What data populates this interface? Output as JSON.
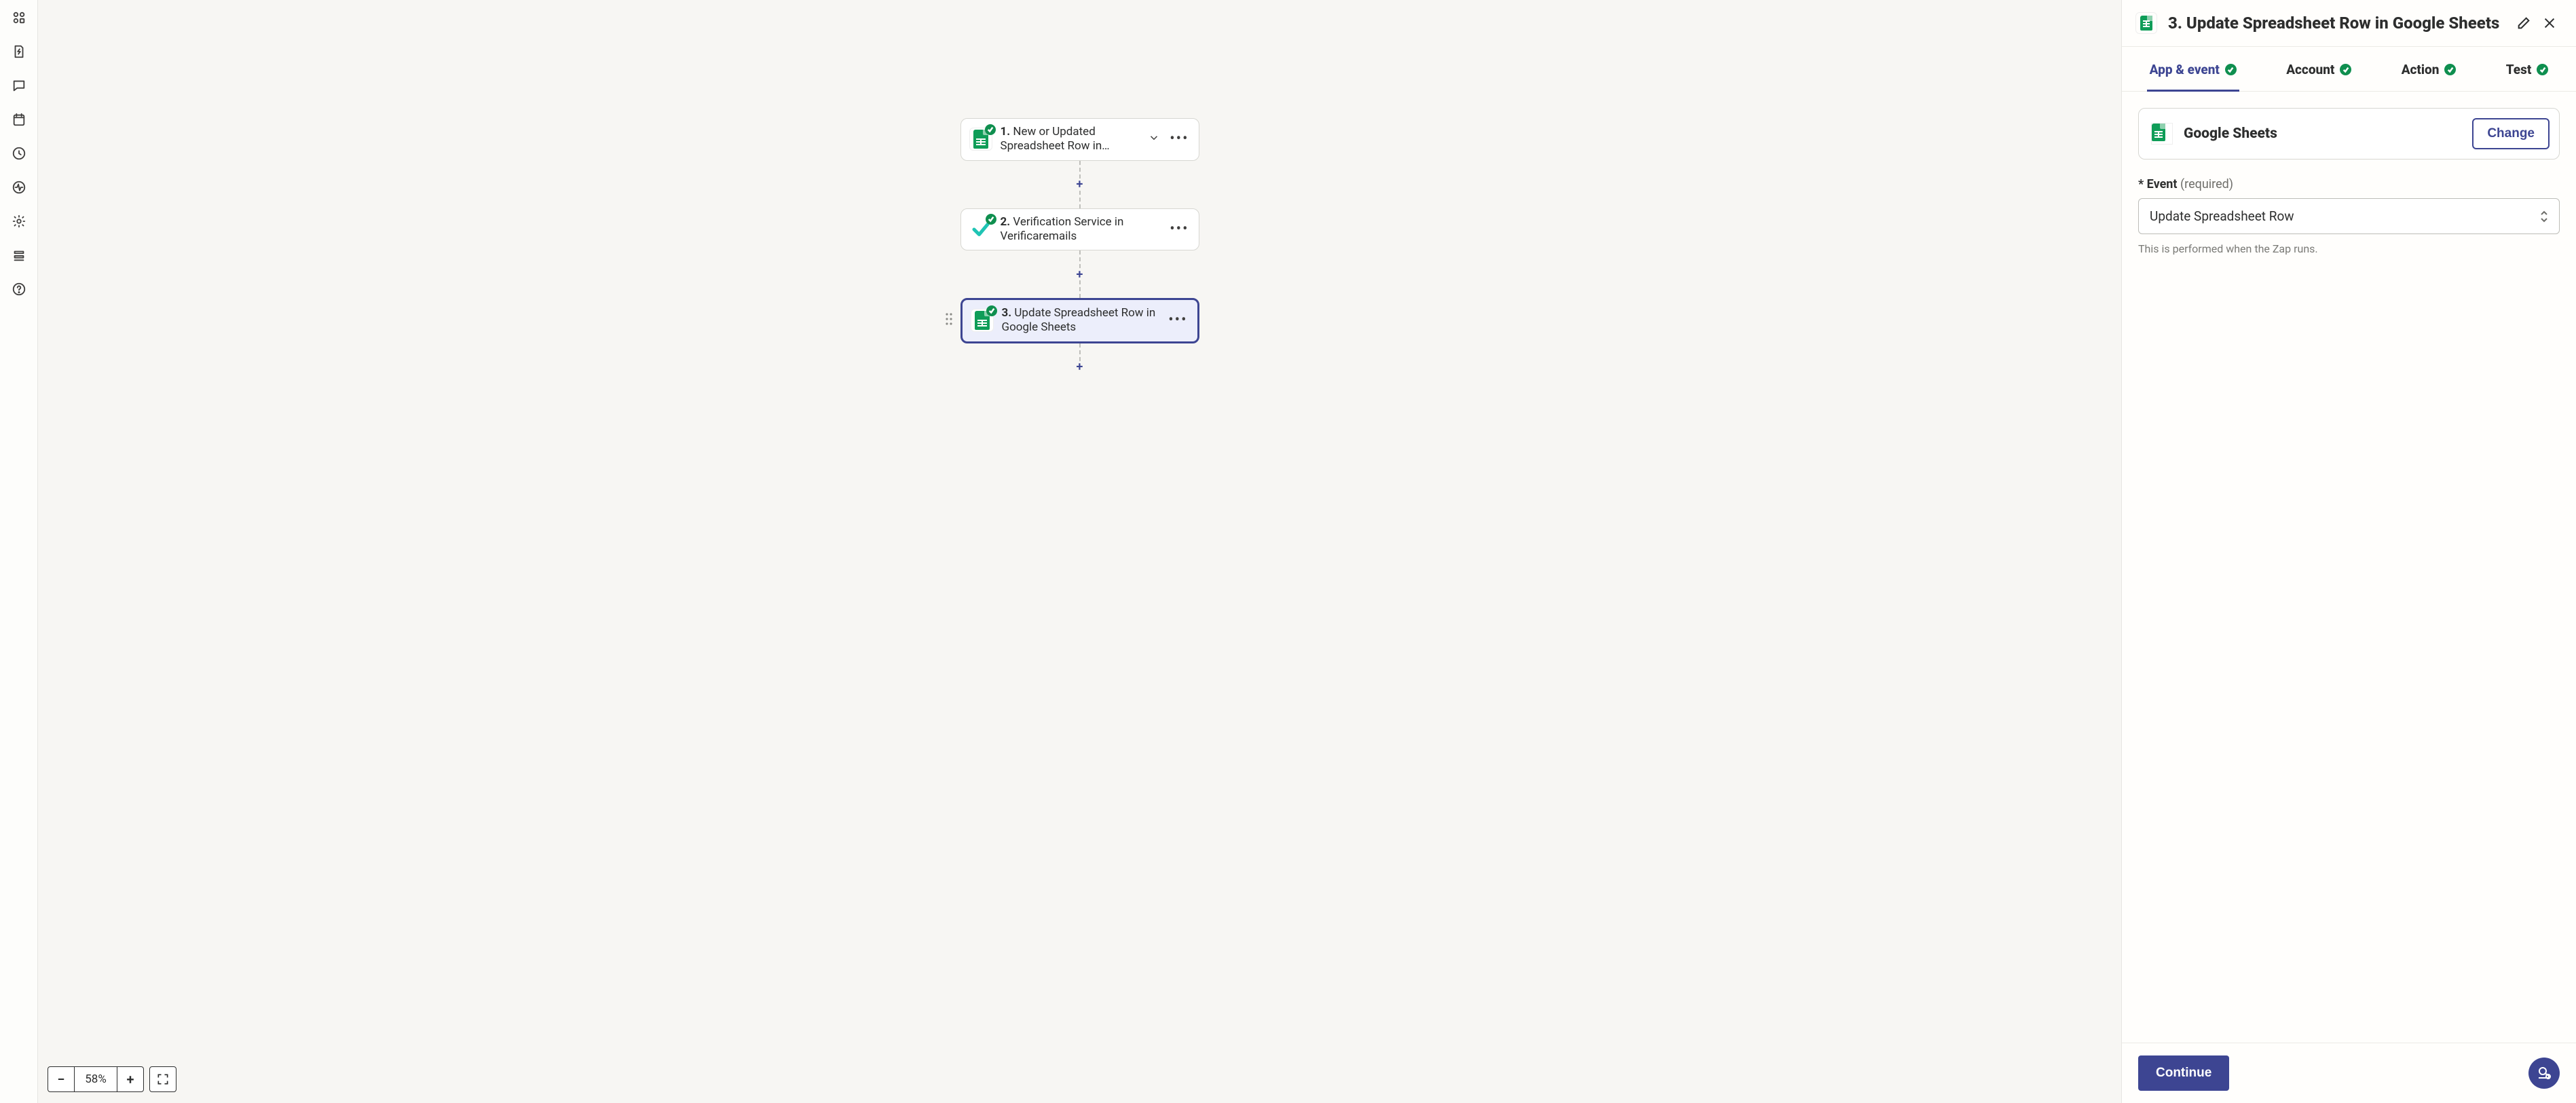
{
  "rail_icons": [
    "grid",
    "bolt-doc",
    "chat",
    "calendar",
    "clock",
    "activity",
    "gear",
    "layers",
    "help"
  ],
  "flow": {
    "nodes": [
      {
        "num": "1.",
        "title": "New or Updated Spreadsheet Row in…",
        "icon": "sheets",
        "showChevron": true
      },
      {
        "num": "2.",
        "title": "Verification Service in Verificaremails",
        "icon": "verify",
        "showChevron": false
      },
      {
        "num": "3.",
        "title": "Update Spreadsheet Row in Google Sheets",
        "icon": "sheets",
        "showChevron": false,
        "selected": true
      }
    ]
  },
  "zoom": {
    "minus": "−",
    "value": "58%",
    "plus": "+"
  },
  "panel": {
    "title": "3. Update Spreadsheet Row in Google Sheets",
    "tabs": [
      {
        "label": "App & event",
        "ok": true,
        "active": true
      },
      {
        "label": "Account",
        "ok": true
      },
      {
        "label": "Action",
        "ok": true
      },
      {
        "label": "Test",
        "ok": true
      }
    ],
    "app": {
      "name": "Google Sheets",
      "change": "Change"
    },
    "event": {
      "label": "Event",
      "required": "(required)",
      "star": "*",
      "value": "Update Spreadsheet Row",
      "helper": "This is performed when the Zap runs."
    },
    "continue": "Continue"
  }
}
